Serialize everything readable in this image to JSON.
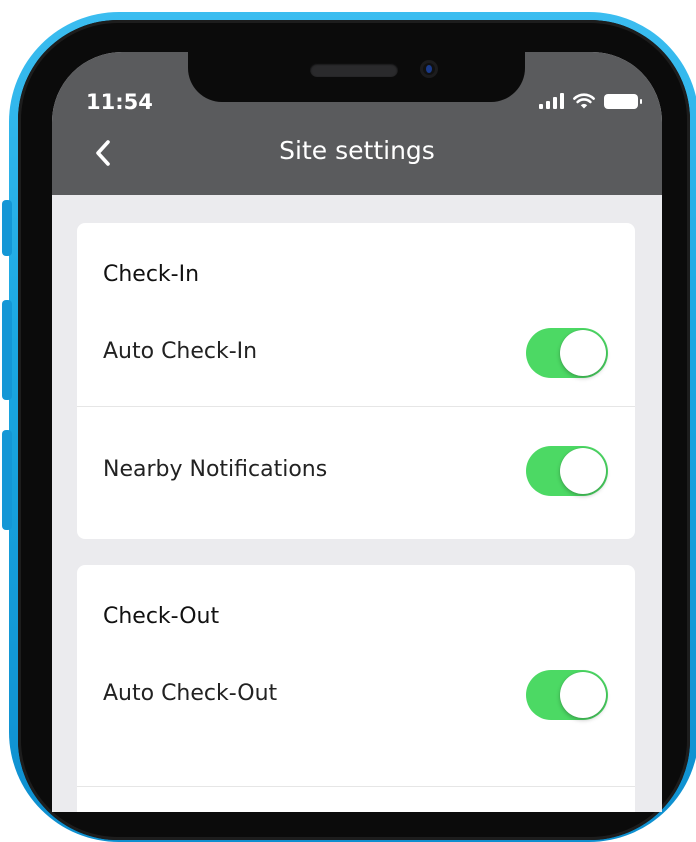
{
  "status_bar": {
    "time": "11:54"
  },
  "nav": {
    "title": "Site settings",
    "back_icon": "chevron-left-icon"
  },
  "colors": {
    "header": "#5a5b5d",
    "toggle_on": "#4cd964",
    "background": "#ebebee",
    "frame": "#1aa7e2"
  },
  "sections": [
    {
      "title": "Check-In",
      "rows": [
        {
          "label": "Auto Check-In",
          "enabled": true
        },
        {
          "label": "Nearby Notifications",
          "enabled": true
        }
      ]
    },
    {
      "title": "Check-Out",
      "rows": [
        {
          "label": "Auto Check-Out",
          "enabled": true
        }
      ]
    }
  ]
}
